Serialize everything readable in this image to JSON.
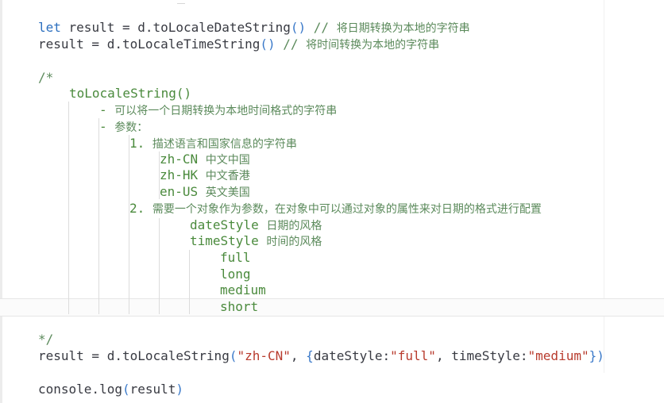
{
  "lines": {
    "l1": {
      "kw": "let",
      "code": " result = d.toLocaleDateString",
      "paren": "()",
      "cm": " // ",
      "cjk": "将日期转换为本地的字符串"
    },
    "l2": {
      "code": "result = d.toLocaleTimeString",
      "paren": "()",
      "cm": " // ",
      "cjk": "将时间转换为本地的字符串"
    },
    "l3": {
      "text": "/*"
    },
    "l4": {
      "text": "toLocaleString()"
    },
    "l5": {
      "dash": "- ",
      "cjk": "可以将一个日期转换为本地时间格式的字符串"
    },
    "l6": {
      "dash": "- ",
      "cjk": "参数："
    },
    "l7": {
      "num": "1. ",
      "cjk": "描述语言和国家信息的字符串"
    },
    "l8": {
      "code": "zh-CN ",
      "cjk": "中文中国"
    },
    "l9": {
      "code": "zh-HK ",
      "cjk": "中文香港"
    },
    "l10": {
      "code": "en-US ",
      "cjk": "英文美国"
    },
    "l11": {
      "num": "2. ",
      "cjk": "需要一个对象作为参数，在对象中可以通过对象的属性来对日期的格式进行配置"
    },
    "l12": {
      "code": "dateStyle ",
      "cjk": "日期的风格"
    },
    "l13": {
      "code": "timeStyle ",
      "cjk": "时间的风格"
    },
    "l14": {
      "text": "full"
    },
    "l15": {
      "text": "long"
    },
    "l16": {
      "text": "medium"
    },
    "l17": {
      "text": "short"
    },
    "l18": {
      "text": "*/"
    },
    "l19": {
      "a": "result = d.toLocaleString",
      "p1": "(",
      "s1": "\"zh-CN\"",
      "c1": ", ",
      "b1": "{",
      "k1": "dateStyle:",
      "s2": "\"full\"",
      "c2": ", ",
      "k2": "timeStyle:",
      "s3": "\"medium\"",
      "b2": "}",
      "p2": ")"
    },
    "l20": {
      "a": "console.log",
      "p1": "(",
      "b": "result",
      "p2": ")"
    }
  }
}
